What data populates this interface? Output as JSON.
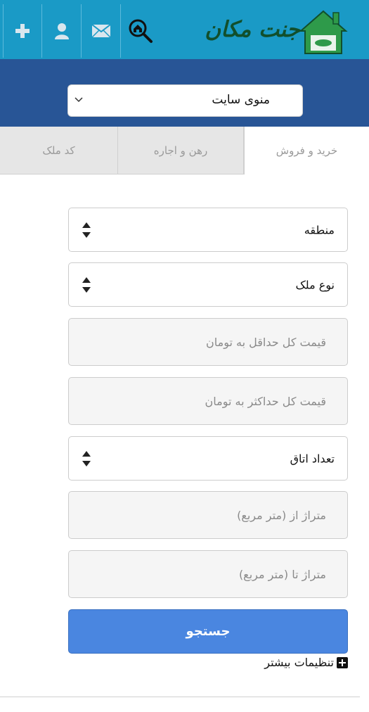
{
  "header": {
    "logo_text": "جنت مکان",
    "icons": [
      "add-icon",
      "user-icon",
      "mail-icon",
      "home-search-icon"
    ]
  },
  "menu": {
    "label": "منوی سایت"
  },
  "tabs": [
    {
      "label": "خرید و فروش",
      "active": true
    },
    {
      "label": "رهن و اجاره",
      "active": false
    },
    {
      "label": "کد ملک",
      "active": false
    }
  ],
  "form": {
    "region_label": "منطقه",
    "property_type_label": "نوع ملک",
    "min_price_placeholder": "قیمت کل حداقل به تومان",
    "max_price_placeholder": "قیمت کل حداکثر به تومان",
    "rooms_label": "تعداد اتاق",
    "area_from_placeholder": "متراژ از (متر مربع)",
    "area_to_placeholder": "متراژ تا (متر مربع)",
    "search_label": "جستجو",
    "more_settings_label": "تنظیمات بیشتر"
  },
  "colors": {
    "topbar": "#1a9ac6",
    "band": "#285596",
    "search_button": "#4a86e0"
  }
}
